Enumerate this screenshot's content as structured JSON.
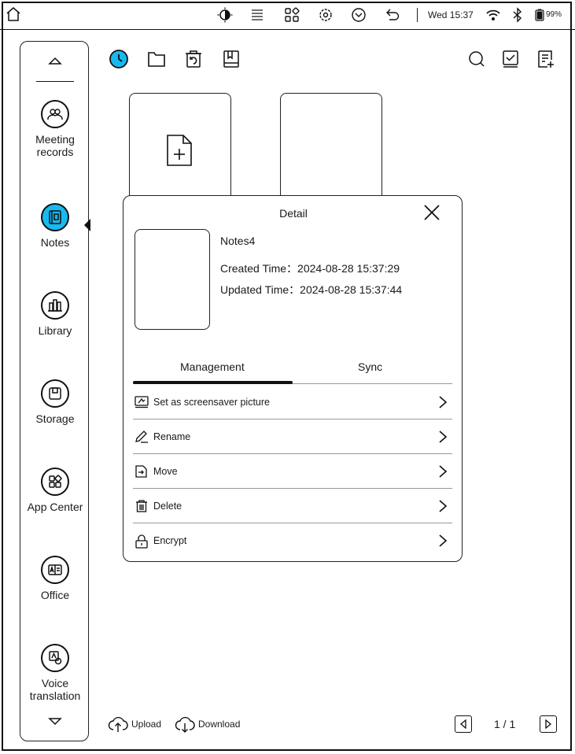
{
  "status_bar": {
    "time": "Wed 15:37",
    "battery": "99%",
    "icons": [
      "home-icon",
      "contrast-icon",
      "menu-lines-icon",
      "apps-grid-icon",
      "settings-icon",
      "chevron-circle-icon",
      "back-icon",
      "wifi-icon",
      "bluetooth-icon",
      "battery-icon"
    ]
  },
  "sidebar": {
    "items": [
      {
        "label": "Meeting records",
        "line1": "Meeting",
        "line2": "records",
        "icon": "meeting-icon"
      },
      {
        "label": "Notes",
        "line1": "Notes",
        "line2": "",
        "icon": "notes-icon",
        "active": true
      },
      {
        "label": "Library",
        "line1": "Library",
        "line2": "",
        "icon": "library-icon"
      },
      {
        "label": "Storage",
        "line1": "Storage",
        "line2": "",
        "icon": "storage-icon"
      },
      {
        "label": "App Center",
        "line1": "App Center",
        "line2": "",
        "icon": "app-center-icon"
      },
      {
        "label": "Office",
        "line1": "Office",
        "line2": "",
        "icon": "office-icon"
      },
      {
        "label": "Voice translation",
        "line1": "Voice",
        "line2": "translation",
        "icon": "voice-translation-icon"
      }
    ],
    "accent_color": "#18b9ef"
  },
  "toolbar": {
    "left": [
      "recent-icon",
      "folder-icon",
      "recycle-bin-icon",
      "bookmark-icon"
    ],
    "right": [
      "search-icon",
      "select-icon",
      "new-note-icon"
    ]
  },
  "dialog": {
    "title": "Detail",
    "name": "Notes4",
    "created_label": "Created Time：",
    "created_value": "2024-08-28 15:37:29",
    "updated_label": "Updated Time：",
    "updated_value": "2024-08-28 15:37:44",
    "tabs": [
      "Management",
      "Sync"
    ],
    "active_tab": "Management",
    "actions": [
      {
        "label": "Set as screensaver picture",
        "icon": "screensaver-icon"
      },
      {
        "label": "Rename",
        "icon": "pencil-icon"
      },
      {
        "label": "Move",
        "icon": "move-icon"
      },
      {
        "label": "Delete",
        "icon": "trash-icon"
      },
      {
        "label": "Encrypt",
        "icon": "lock-icon"
      }
    ]
  },
  "bottom": {
    "upload": "Upload",
    "download": "Download",
    "page": "1 / 1"
  }
}
